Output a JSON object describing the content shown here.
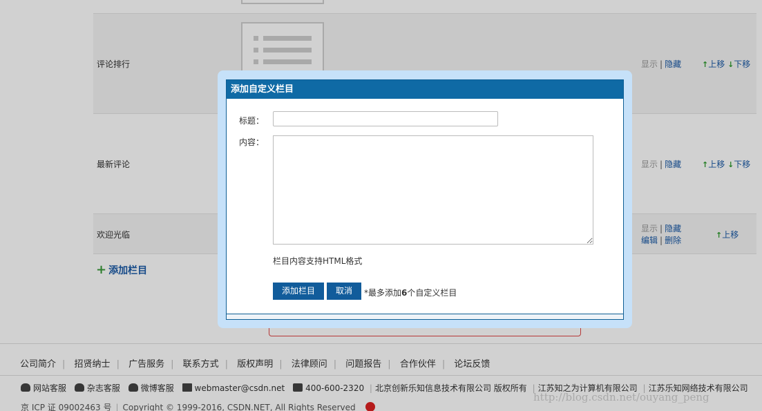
{
  "rows": [
    {
      "name": "评论排行",
      "show": "显示",
      "hide": "隐藏",
      "up": "上移",
      "down": "下移"
    },
    {
      "name": "最新评论",
      "show": "显示",
      "hide": "隐藏",
      "up": "上移",
      "down": "下移"
    },
    {
      "name": "欢迎光临",
      "show": "显示",
      "hide": "隐藏",
      "edit": "编辑",
      "delete": "删除",
      "up": "上移"
    }
  ],
  "add_column_label": "添加栏目",
  "modal": {
    "title": "添加自定义栏目",
    "title_label": "标题：",
    "title_value": "",
    "content_label": "内容：",
    "content_value": "",
    "hint": "栏目内容支持HTML格式",
    "add_button": "添加栏目",
    "cancel_button": "取消",
    "limit_prefix": "*最多添加",
    "limit_count": "6",
    "limit_suffix": "个自定义栏目"
  },
  "footer": {
    "links": [
      "公司简介",
      "招贤纳士",
      "广告服务",
      "联系方式",
      "版权声明",
      "法律顾问",
      "问题报告",
      "合作伙伴",
      "论坛反馈"
    ],
    "site_service": "网站客服",
    "magazine_service": "杂志客服",
    "weibo_service": "微博客服",
    "email": "webmaster@csdn.net",
    "phone": "400-600-2320",
    "company1": "北京创新乐知信息技术有限公司 版权所有",
    "company2": "江苏知之为计算机有限公司",
    "company3": "江苏乐知网络技术有限公司",
    "icp": "京 ICP 证 09002463 号",
    "copyright": "Copyright © 1999-2016, CSDN.NET, All Rights Reserved"
  },
  "watermark": "http://blog.csdn.net/ouyang_peng",
  "colors": {
    "accent": "#0f6aa5",
    "link": "#1a5aa6",
    "modal_frame": "#c6e1f9"
  }
}
